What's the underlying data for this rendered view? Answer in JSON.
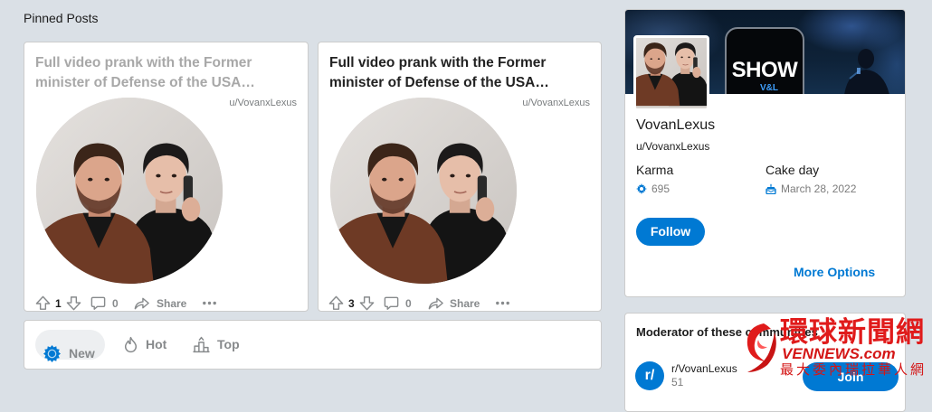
{
  "colors": {
    "page_bg": "#dae0e6",
    "accent": "#0079d3",
    "visited_title": "#a8a8a8",
    "watermark_red": "#e01b1b"
  },
  "section": {
    "title": "Pinned Posts"
  },
  "pinned_posts": [
    {
      "title": "Full video prank with the Former minister of Defense of the USA…",
      "author": "u/VovanxLexus",
      "votes": "1",
      "comments": "0",
      "share_label": "Share",
      "visited": true,
      "icons": [
        "upvote-icon",
        "downvote-icon",
        "comment-icon",
        "share-icon",
        "more-dots-icon"
      ]
    },
    {
      "title": "Full video prank with the Former minister of Defense of the USA…",
      "author": "u/VovanxLexus",
      "votes": "3",
      "comments": "0",
      "share_label": "Share",
      "visited": false,
      "icons": [
        "upvote-icon",
        "downvote-icon",
        "comment-icon",
        "share-icon",
        "more-dots-icon"
      ]
    }
  ],
  "sort_bar": {
    "items": [
      {
        "label": "New",
        "icon": "new-burst-icon",
        "active": true
      },
      {
        "label": "Hot",
        "icon": "flame-icon",
        "active": false
      },
      {
        "label": "Top",
        "icon": "top-chart-icon",
        "active": false
      }
    ]
  },
  "profile": {
    "banner": {
      "logo_top": "SHOW",
      "logo_bottom": "V&L"
    },
    "display_name": "VovanLexus",
    "username": "u/VovanxLexus",
    "karma": {
      "label": "Karma",
      "value": "695",
      "icon": "karma-icon"
    },
    "cake_day": {
      "label": "Cake day",
      "value": "March 28, 2022",
      "icon": "cake-icon"
    },
    "follow_label": "Follow",
    "more_options_label": "More Options"
  },
  "moderator": {
    "heading": "Moderator of these communities",
    "communities": [
      {
        "logo_text": "r/",
        "name": "r/VovanLexus",
        "members": "51",
        "join_label": "Join"
      }
    ]
  },
  "watermark": {
    "line1": "環球新聞網",
    "line2": "VENNEWS.com",
    "line3": "最大委內瑞拉華人網",
    "icon": "swirl-logo-icon"
  }
}
